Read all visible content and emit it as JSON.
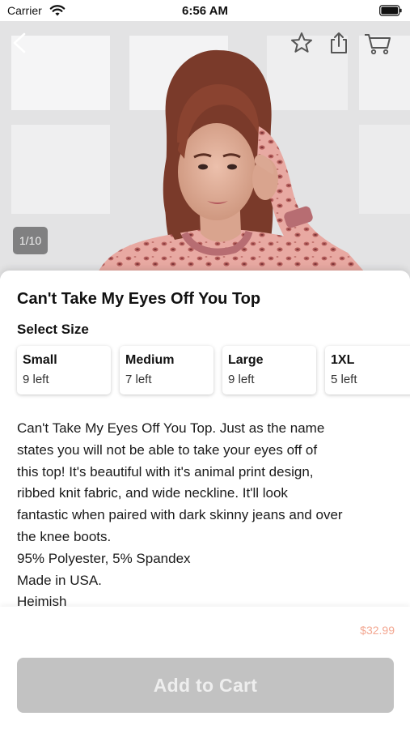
{
  "status_bar": {
    "carrier": "Carrier",
    "time": "6:56 AM"
  },
  "hero": {
    "image_counter": "1/10",
    "icons": [
      "chevron-left-icon",
      "star-icon",
      "share-icon",
      "cart-icon"
    ]
  },
  "product": {
    "title": "Can't Take My Eyes Off You Top",
    "size_heading": "Select Size",
    "sizes": [
      {
        "label": "Small",
        "stock": "9 left"
      },
      {
        "label": "Medium",
        "stock": "7 left"
      },
      {
        "label": "Large",
        "stock": "9 left"
      },
      {
        "label": "1XL",
        "stock": "5 left"
      }
    ],
    "description_lines": [
      "Can't Take My Eyes Off You Top. Just as the name",
      "states you will not be able to take your eyes off of",
      "this top! It's beautiful with it's animal print design,",
      "ribbed knit fabric, and wide neckline. It'll look",
      "fantastic when paired with dark skinny jeans and over",
      "the knee boots.",
      "95% Polyester, 5% Spandex",
      "Made in USA.",
      "Heimish"
    ]
  },
  "footer": {
    "price": "$32.99",
    "add_to_cart_label": "Add to Cart"
  },
  "colors": {
    "price": "#f3a791",
    "button_background": "#c2c2c2",
    "button_text": "#eeeeee"
  }
}
